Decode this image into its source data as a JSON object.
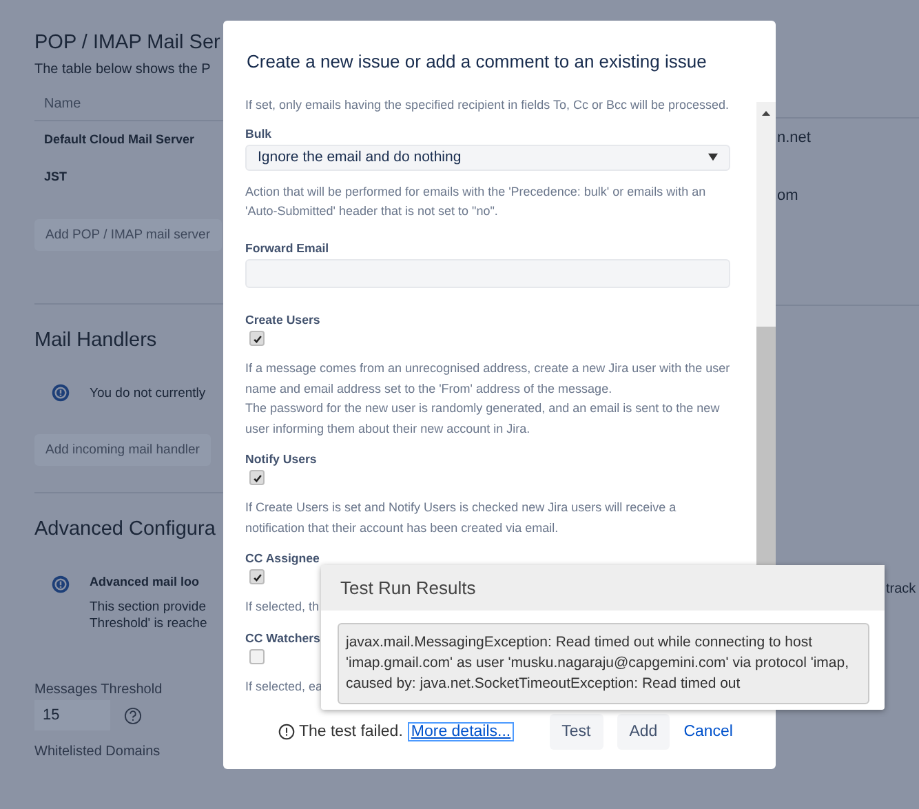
{
  "background_page": {
    "mail_servers": {
      "title": "POP / IMAP Mail Ser",
      "description": "The table below shows the P",
      "columns": [
        "Name"
      ],
      "rows": [
        {
          "name": "Default Cloud Mail Server",
          "column_2": "n.net"
        },
        {
          "name": "JST",
          "column_2": "om"
        }
      ],
      "add_button": "Add POP / IMAP mail server"
    },
    "mail_handlers": {
      "title": "Mail Handlers",
      "notice": "You do not currently",
      "add_button": "Add incoming mail handler"
    },
    "advanced": {
      "title": "Advanced Configura",
      "notice_title": "Advanced mail loo",
      "notice_lines": [
        "This section provide",
        "Threshold' is reache"
      ],
      "notice_fragment": "track",
      "threshold_label": "Messages Threshold",
      "threshold_value": "15",
      "whitelist_label": "Whitelisted Domains"
    }
  },
  "dialog": {
    "title": "Create a new issue or add a comment to an existing issue",
    "fields": [
      {
        "kind": "note",
        "help": [
          "If set, only emails having the specified recipient in fields To, Cc or Bcc will be processed."
        ]
      },
      {
        "kind": "select",
        "label": "Bulk",
        "value": "Ignore the email and do nothing",
        "help": [
          "Action that will be performed for emails with the 'Precedence: bulk' or emails with an 'Auto-Submitted' header that is not set to \"no\"."
        ]
      },
      {
        "kind": "text",
        "label": "Forward Email"
      },
      {
        "kind": "checkbox",
        "label": "Create Users",
        "checked": true,
        "help": [
          "If a message comes from an unrecognised address, create a new Jira user with the user name and email address set to the 'From' address of the message.",
          "The password for the new user is randomly generated, and an email is sent to the new user informing them about their new account in Jira."
        ]
      },
      {
        "kind": "checkbox",
        "label": "Notify Users",
        "checked": true,
        "help": [
          "If Create Users is set and Notify Users is checked new Jira users will receive a notification that their account has been created via email."
        ]
      },
      {
        "kind": "checkbox",
        "label": "CC Assignee",
        "checked": true,
        "help": [
          "If selected, th"
        ]
      },
      {
        "kind": "checkbox",
        "label": "CC Watchers",
        "checked": false,
        "help": [
          "If selected, ea"
        ]
      }
    ],
    "footer": {
      "status": "The test failed.",
      "link": "More details...",
      "buttons": [
        {
          "kind": "button",
          "label": "Test"
        },
        {
          "kind": "button",
          "label": "Add"
        },
        {
          "kind": "link",
          "label": "Cancel"
        }
      ]
    }
  },
  "test_results": {
    "title": "Test Run Results",
    "message_lines": [
      "javax.mail.MessagingException: Read timed out while connecting to host",
      "'imap.gmail.com' as user 'musku.nagaraju@capgemini.com' via protocol 'imap,",
      "caused by: java.net.SocketTimeoutException: Read timed out"
    ]
  }
}
